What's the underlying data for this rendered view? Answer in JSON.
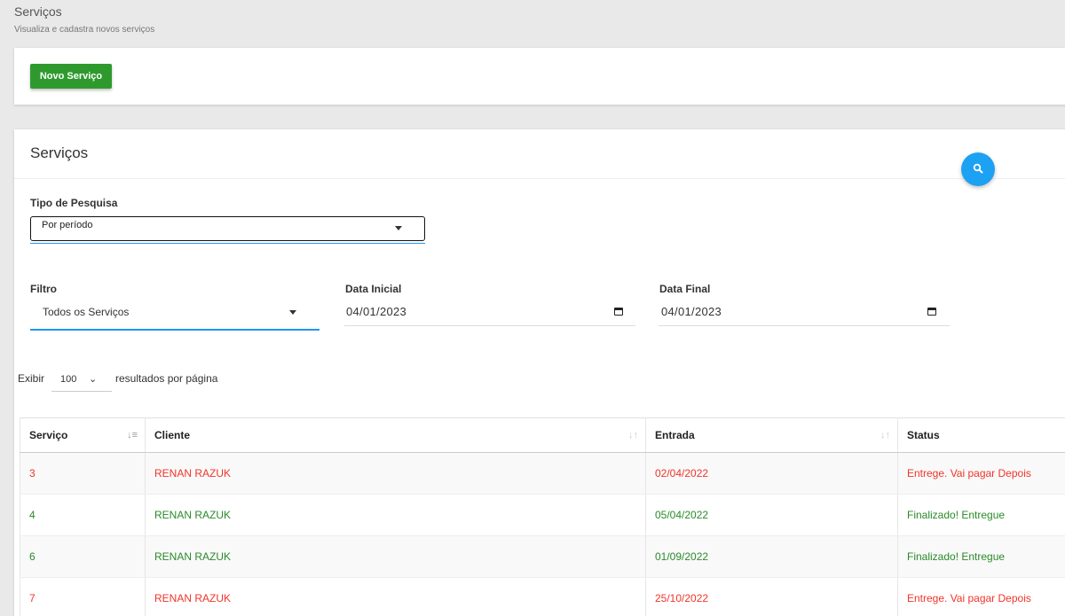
{
  "header": {
    "title": "Serviços",
    "subtitle": "Visualiza e cadastra novos serviços"
  },
  "toolbar": {
    "new_label": "Novo Serviço"
  },
  "card": {
    "title": "Serviços"
  },
  "filters": {
    "tipo_label": "Tipo de Pesquisa",
    "tipo_value": "Por período",
    "filtro_label": "Filtro",
    "filtro_value": "Todos os Serviços",
    "data_inicial_label": "Data Inicial",
    "data_inicial_value": "04/01/2023",
    "data_final_label": "Data Final",
    "data_final_value": "04/01/2023"
  },
  "pagination": {
    "exibir": "Exibir",
    "per_page": "100",
    "resultados": "resultados por página"
  },
  "table": {
    "columns": [
      "Serviço",
      "Cliente",
      "Entrada",
      "Status"
    ],
    "rows": [
      {
        "servico": "3",
        "cliente": "RENAN RAZUK",
        "entrada": "02/04/2022",
        "status": "Entrege. Vai pagar Depois",
        "color": "#f0352a"
      },
      {
        "servico": "4",
        "cliente": "RENAN RAZUK",
        "entrada": "05/04/2022",
        "status": "Finalizado! Entregue",
        "color": "#2a8a2a"
      },
      {
        "servico": "6",
        "cliente": "RENAN RAZUK",
        "entrada": "01/09/2022",
        "status": "Finalizado! Entregue",
        "color": "#2a8a2a"
      },
      {
        "servico": "7",
        "cliente": "RENAN RAZUK",
        "entrada": "25/10/2022",
        "status": "Entrege. Vai pagar Depois",
        "color": "#f0352a"
      }
    ]
  },
  "colors": {
    "primary_button": "#2e9a2e",
    "search_button": "#1da1f2",
    "focus_line": "#2196f3"
  },
  "icons": {
    "search": "search-icon",
    "calendar": "calendar-icon",
    "sort": "sort-icon",
    "dropdown": "caret-down-icon"
  }
}
